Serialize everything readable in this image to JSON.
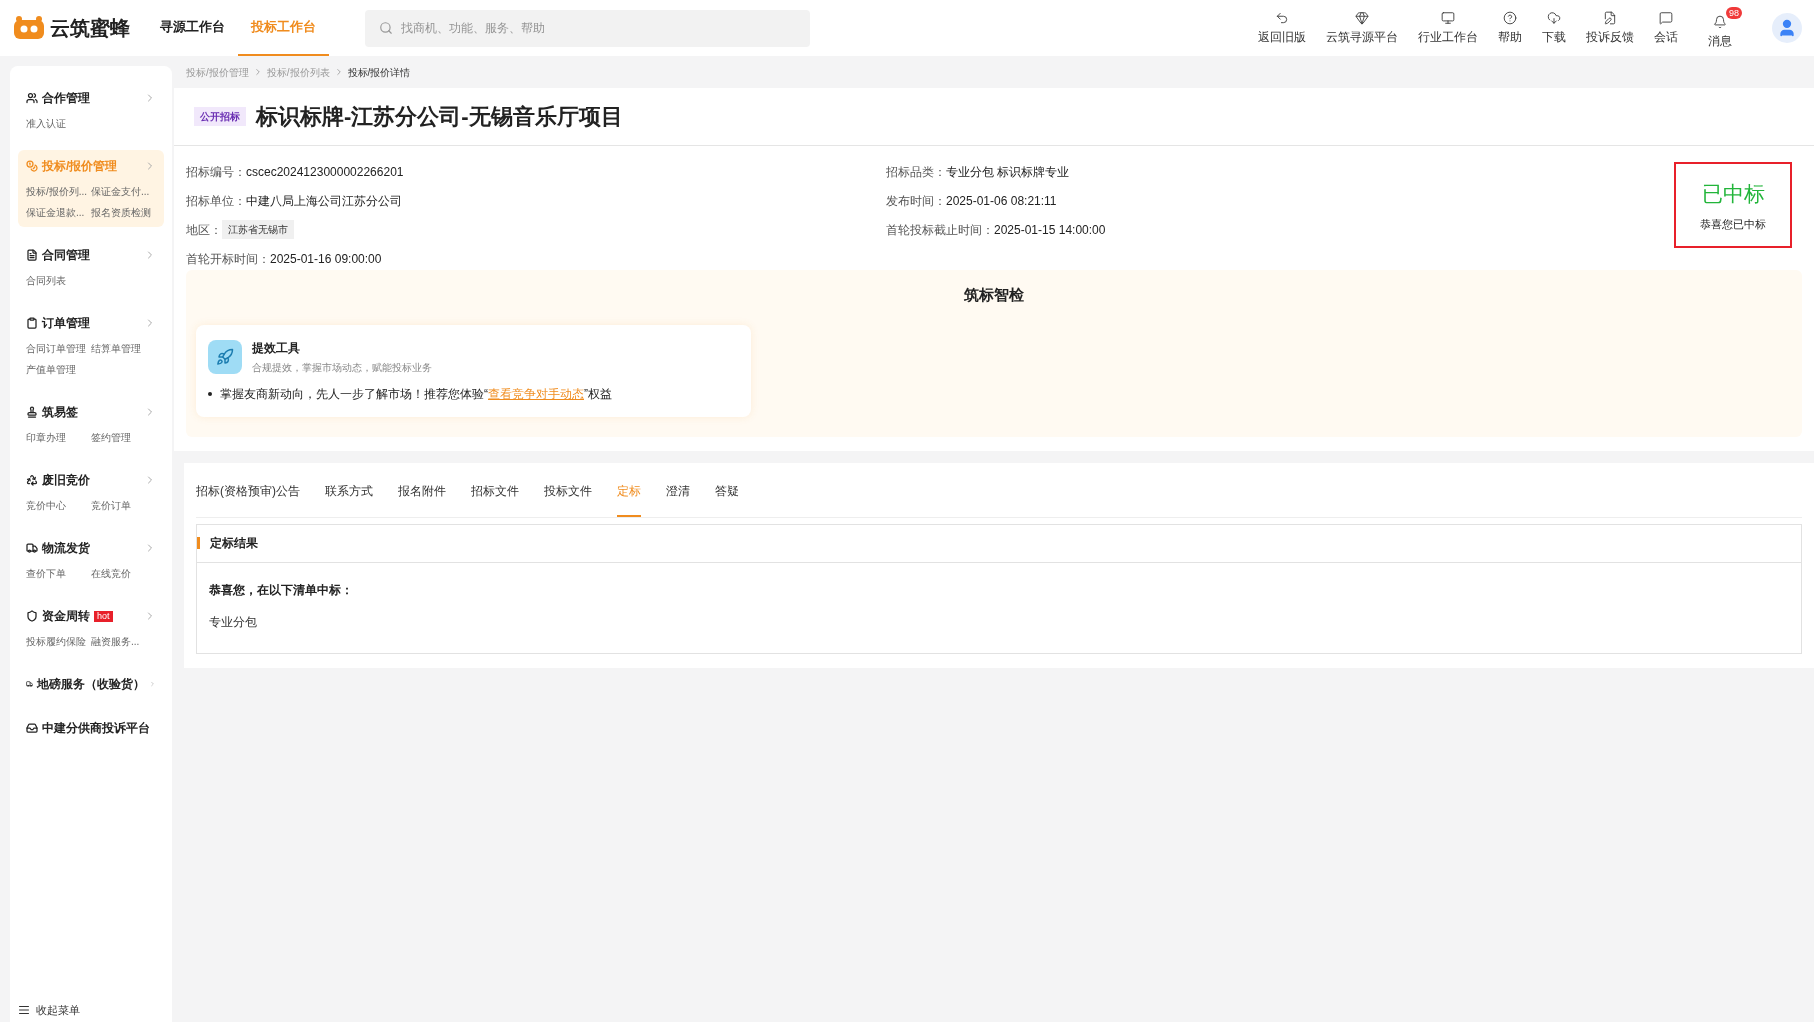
{
  "header": {
    "logo": "云筑蜜蜂",
    "nav": [
      {
        "label": "寻源工作台",
        "selected": false
      },
      {
        "label": "投标工作台",
        "selected": true
      }
    ],
    "search": {
      "placeholder": "找商机、功能、服务、帮助"
    },
    "actions": [
      {
        "kind": "undo",
        "label": "返回旧版"
      },
      {
        "kind": "diamond",
        "label": "云筑寻源平台"
      },
      {
        "kind": "monitor",
        "label": "行业工作台"
      },
      {
        "kind": "help",
        "label": "帮助"
      },
      {
        "kind": "download",
        "label": "下载"
      },
      {
        "kind": "file",
        "label": "投诉反馈"
      },
      {
        "kind": "chat",
        "label": "会话"
      },
      {
        "kind": "bell",
        "label": "消息",
        "badge": "98"
      }
    ]
  },
  "sidebar": {
    "groups": [
      {
        "kind": "menu",
        "title": "合作管理",
        "selected": false,
        "items": [
          "准入认证"
        ]
      },
      {
        "kind": "menu",
        "title": "投标/报价管理",
        "selected": true,
        "items": [
          "投标/报价列...",
          "保证金支付...",
          "保证金退款...",
          "报名资质检测"
        ]
      },
      {
        "kind": "menu",
        "title": "合同管理",
        "selected": false,
        "items": [
          "合同列表"
        ]
      },
      {
        "kind": "menu",
        "title": "订单管理",
        "selected": false,
        "items": [
          "合同订单管理",
          "结算单管理",
          "产值单管理"
        ]
      },
      {
        "kind": "menu",
        "title": "筑易签",
        "selected": false,
        "items": [
          "印章办理",
          "签约管理"
        ]
      },
      {
        "kind": "menu",
        "title": "废旧竞价",
        "selected": false,
        "items": [
          "竞价中心",
          "竞价订单"
        ]
      },
      {
        "kind": "menu",
        "title": "物流发货",
        "selected": false,
        "items": [
          "查价下单",
          "在线竞价"
        ]
      },
      {
        "kind": "menu",
        "title": "资金周转",
        "badge": "hot",
        "selected": false,
        "items": [
          "投标履约保险",
          "融资服务..."
        ]
      },
      {
        "kind": "menu",
        "title": "地磅服务（收验货）",
        "selected": false
      },
      {
        "kind": "link",
        "title": "中建分供商投诉平台",
        "selected": false
      }
    ],
    "collapse": "收起菜单"
  },
  "breadcrumb": [
    "投标/报价管理",
    "投标/报价列表",
    "投标/报价详情"
  ],
  "project": {
    "tag": "公开招标",
    "title": "标识标牌-江苏分公司-无锡音乐厅项目",
    "left_fields": [
      {
        "label": "招标编号：",
        "value": "cscec2024123000002266201"
      },
      {
        "label": "招标单位：",
        "value": "中建八局上海公司江苏分公司"
      },
      {
        "label": "地区：",
        "value": "江苏省无锡市",
        "kind": "chip"
      },
      {
        "label": "首轮开标时间：",
        "value": "2025-01-16 09:00:00"
      }
    ],
    "right_fields": [
      {
        "label": "招标品类：",
        "value": "专业分包 标识标牌专业"
      },
      {
        "label": "发布时间：",
        "value": "2025-01-06 08:21:11"
      },
      {
        "label": "首轮投标截止时间：",
        "value": "2025-01-15 14:00:00"
      }
    ],
    "status": {
      "title": "已中标",
      "subtitle": "恭喜您已中标"
    }
  },
  "check": {
    "title": "筑标智检",
    "tool": {
      "title": "提效工具",
      "subtitle": "合规提效，掌握市场动态，赋能投标业务",
      "tip_before": "掌握友商新动向，先人一步了解市场！推荐您体验“",
      "link": "查看竞争对手动态",
      "tip_after": "”权益"
    }
  },
  "tabs": [
    {
      "label": "招标(资格预审)公告",
      "selected": false
    },
    {
      "label": "联系方式",
      "selected": false
    },
    {
      "label": "报名附件",
      "selected": false
    },
    {
      "label": "招标文件",
      "selected": false
    },
    {
      "label": "投标文件",
      "selected": false
    },
    {
      "label": "定标",
      "selected": true
    },
    {
      "label": "澄清",
      "selected": false
    },
    {
      "label": "答疑",
      "selected": false
    }
  ],
  "result": {
    "title": "定标结果",
    "heading": "恭喜您，在以下清单中标：",
    "items": [
      "专业分包"
    ]
  }
}
